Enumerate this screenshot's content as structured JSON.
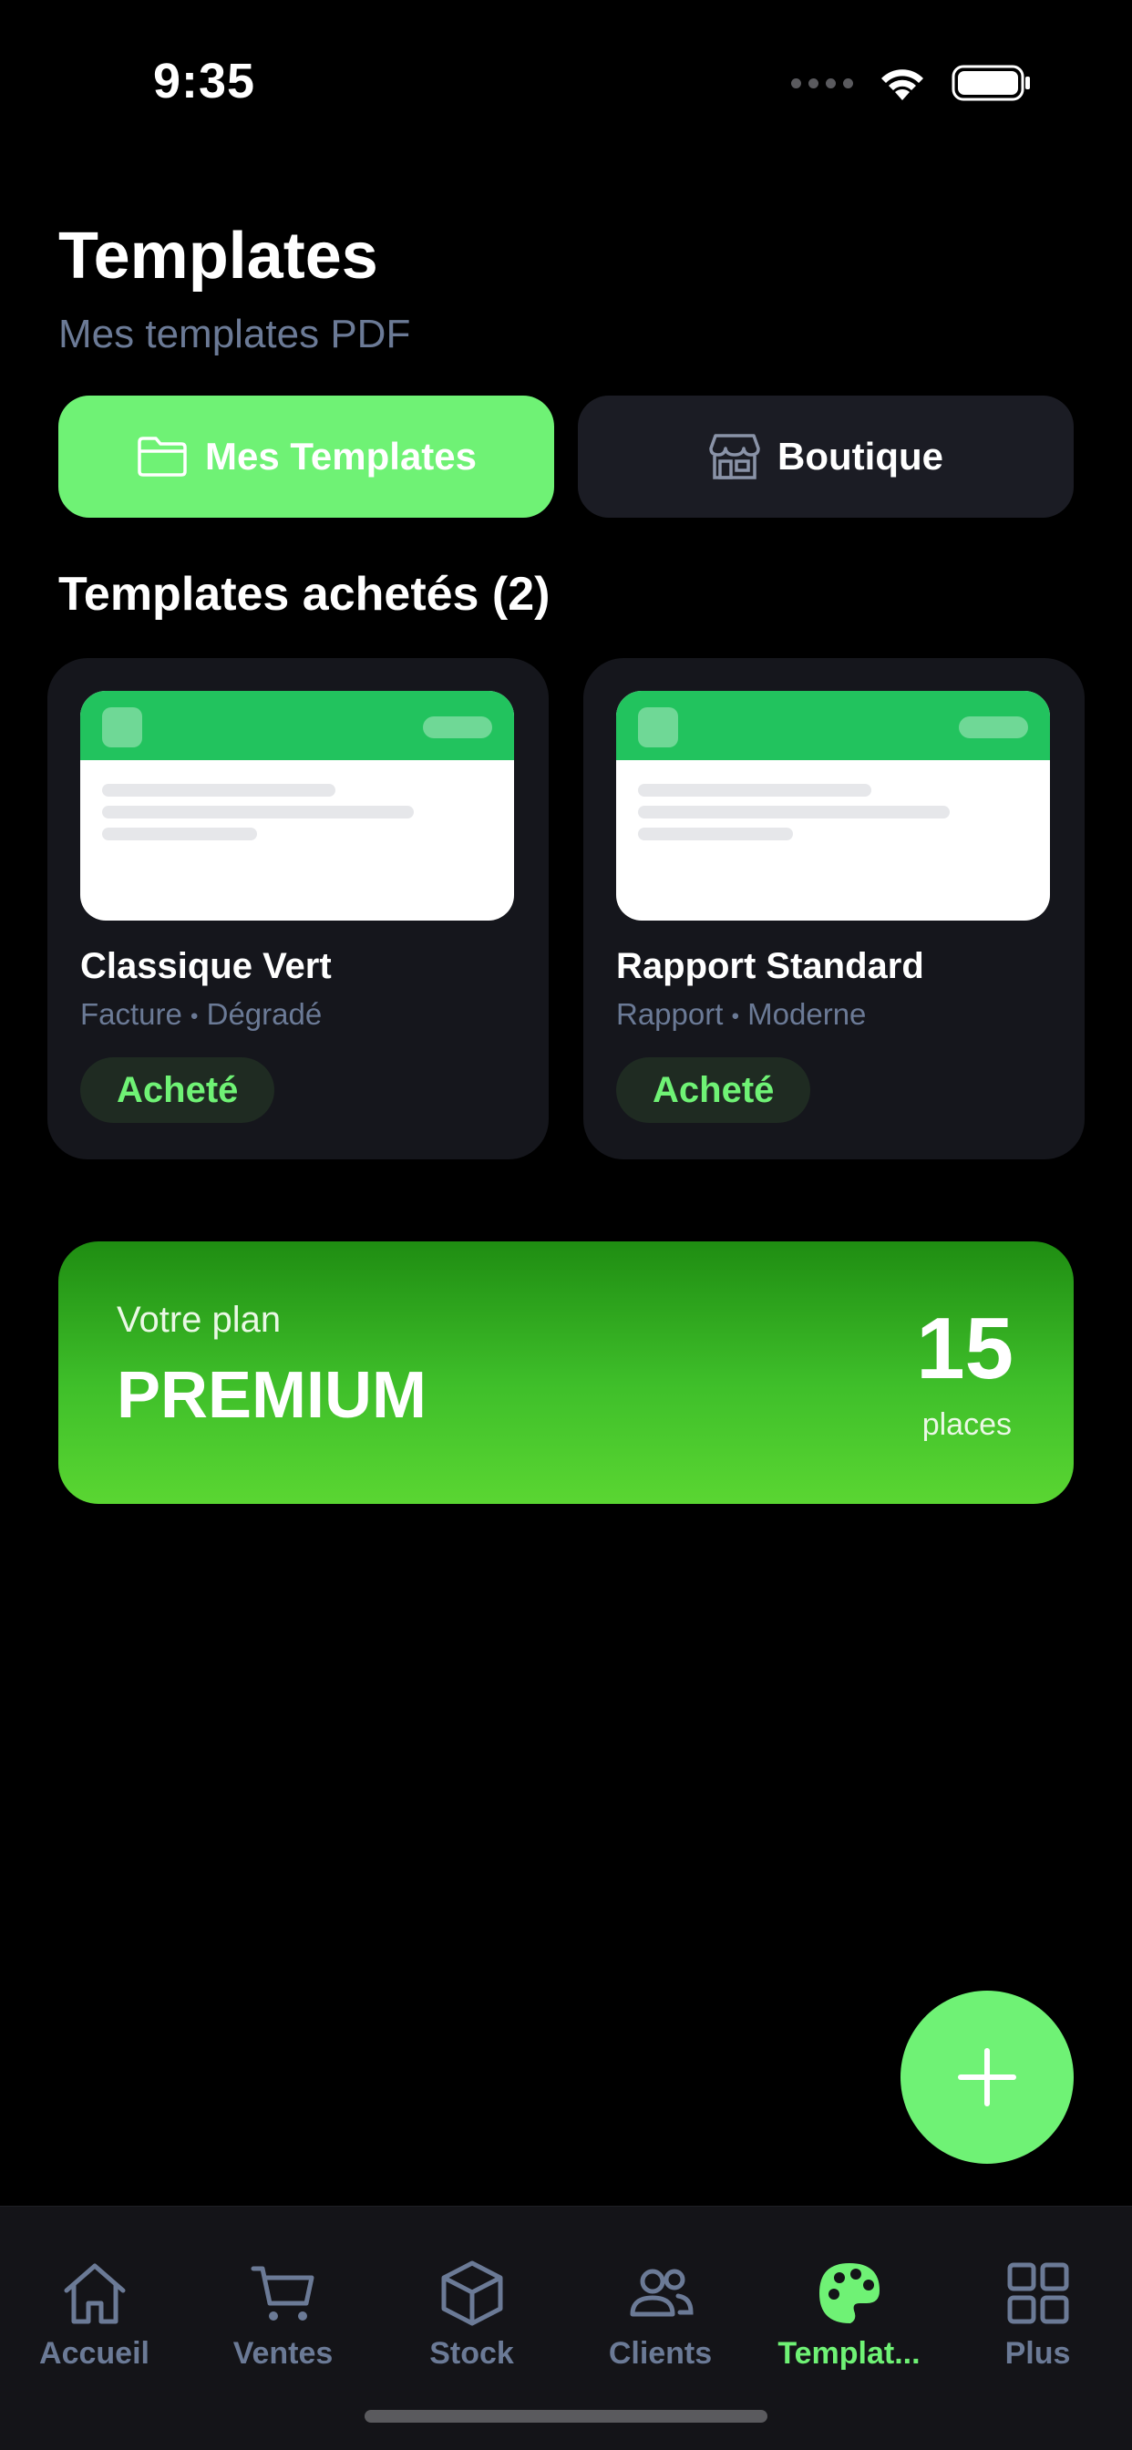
{
  "status_bar": {
    "time": "9:35"
  },
  "header": {
    "title": "Templates",
    "subtitle": "Mes templates PDF"
  },
  "segments": {
    "mine_label": "Mes Templates",
    "shop_label": "Boutique"
  },
  "section": {
    "title": "Templates achetés (2)"
  },
  "templates": [
    {
      "name": "Classique Vert",
      "category": "Facture",
      "style": "Dégradé",
      "badge": "Acheté"
    },
    {
      "name": "Rapport Standard",
      "category": "Rapport",
      "style": "Moderne",
      "badge": "Acheté"
    }
  ],
  "meta_separator": "•",
  "plan": {
    "label": "Votre plan",
    "name": "PREMIUM",
    "count": "15",
    "unit": "places"
  },
  "tabs": [
    {
      "label": "Accueil",
      "icon": "home-icon"
    },
    {
      "label": "Ventes",
      "icon": "cart-icon"
    },
    {
      "label": "Stock",
      "icon": "box-icon"
    },
    {
      "label": "Clients",
      "icon": "users-icon"
    },
    {
      "label": "Templat...",
      "icon": "palette-icon",
      "active": true
    },
    {
      "label": "Plus",
      "icon": "grid-icon"
    }
  ],
  "colors": {
    "accent": "#6ff275",
    "muted": "#6b7a96",
    "card": "#15161c",
    "background": "#000000"
  }
}
